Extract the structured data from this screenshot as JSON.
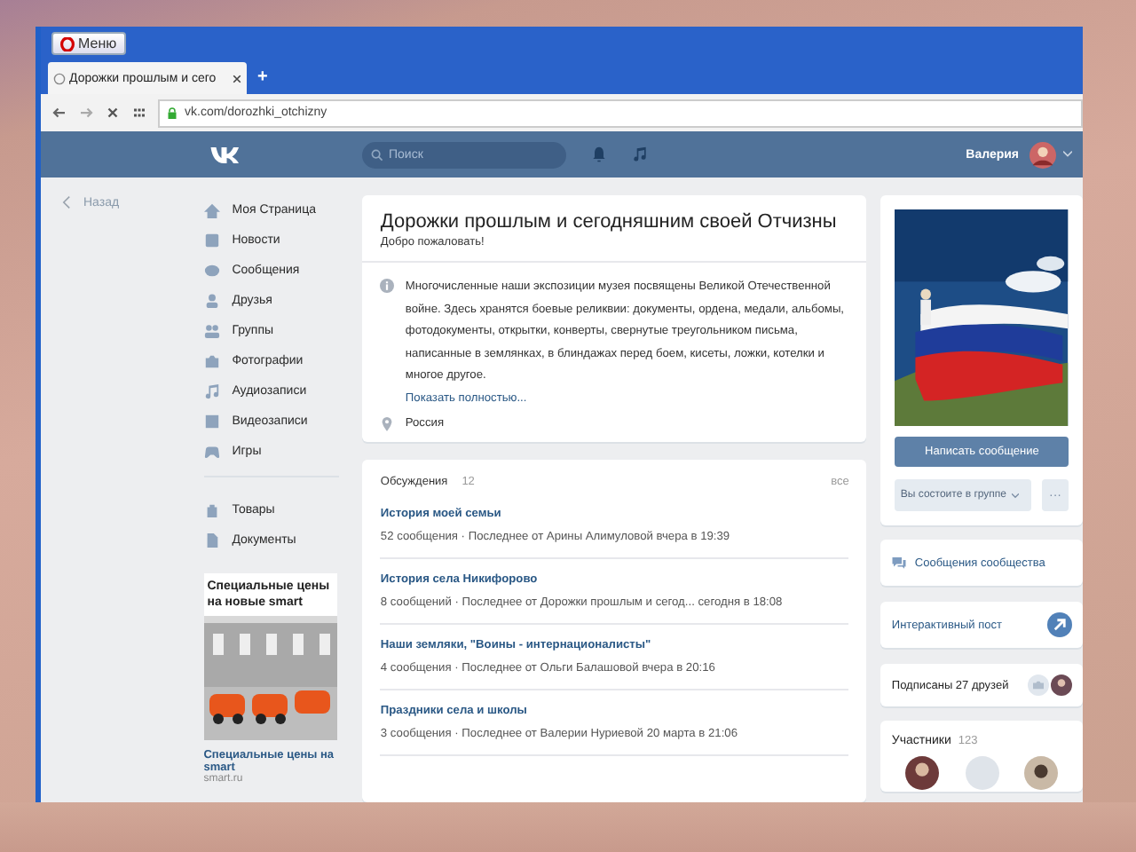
{
  "browser": {
    "menu_button": "Меню",
    "tabs": [
      {
        "title": "Дорожки прошлым и сего",
        "selected": true
      }
    ],
    "new_tab": "+",
    "address": "vk.com/dorozhki_otchizny"
  },
  "header": {
    "search_placeholder": "Поиск",
    "user_name": "Валерия"
  },
  "back_link": "Назад",
  "sidebar": {
    "items": [
      {
        "label": "Моя Страница",
        "kind": "home"
      },
      {
        "label": "Новости",
        "kind": "news"
      },
      {
        "label": "Сообщения",
        "kind": "messages"
      },
      {
        "label": "Друзья",
        "kind": "friend"
      },
      {
        "label": "Группы",
        "kind": "groups"
      },
      {
        "label": "Фотографии",
        "kind": "camera"
      },
      {
        "label": "Аудиозаписи",
        "kind": "music"
      },
      {
        "label": "Видеозаписи",
        "kind": "video"
      },
      {
        "label": "Игры",
        "kind": "games"
      }
    ],
    "extra_items": [
      {
        "label": "Товары",
        "kind": "bag"
      },
      {
        "label": "Документы",
        "kind": "doc"
      }
    ]
  },
  "ad": {
    "title": "Специальные цены на новые smart",
    "caption": "Специальные цены на smart",
    "domain": "smart.ru"
  },
  "group": {
    "title": "Дорожки прошлым и сегодняшним своей Отчизны",
    "status": "Добро пожаловать!",
    "description": "Многочисленные наши экспозиции музея посвящены Великой Отечественной войне. Здесь хранятся боевые реликвии: документы, ордена, медали, альбомы, фотодокументы, открытки, конверты, свернутые треугольником письма, написанные в землянках, в блиндажах перед боем, кисеты, ложки, котелки и многое другое.",
    "more_link": "Показать полностью...",
    "location": "Россия"
  },
  "discussions": {
    "title": "Обсуждения",
    "count": "12",
    "all_link": "все",
    "topics": [
      {
        "title": "История моей семьи",
        "meta": "52 сообщения · Последнее от Арины Алимуловой вчера в 19:39"
      },
      {
        "title": "История села Никифорово",
        "meta": "8 сообщений · Последнее от Дорожки прошлым и сегод... сегодня в 18:08"
      },
      {
        "title": "Наши земляки, \"Воины - интернационалисты\"",
        "meta": "4 сообщения · Последнее от Ольги Балашовой вчера в 20:16"
      },
      {
        "title": "Праздники села и школы",
        "meta": "3 сообщения · Последнее от Валерии Нуриевой 20 марта в 21:06"
      }
    ]
  },
  "profile": {
    "write_button": "Написать сообщение",
    "member_button": "Вы состоите в группе",
    "more_button": "···"
  },
  "widgets": [
    {
      "kind": "messages",
      "label": "Сообщения сообщества"
    },
    {
      "kind": "post",
      "label": "Интерактивный пост"
    },
    {
      "kind": "friends",
      "label": "Подписаны 27 друзей"
    }
  ],
  "members": {
    "title": "Участники",
    "count": "123"
  }
}
